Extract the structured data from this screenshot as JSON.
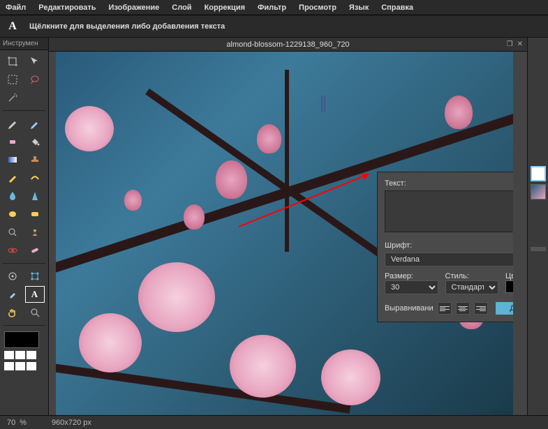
{
  "menu": {
    "items": [
      "Файл",
      "Редактировать",
      "Изображение",
      "Слой",
      "Коррекция",
      "Фильтр",
      "Просмотр",
      "Язык",
      "Справка"
    ]
  },
  "subbar": {
    "tool_letter": "A",
    "hint": "Щёлкните для выделения либо добавления текста"
  },
  "toolpanel": {
    "title": "Инструмен"
  },
  "document": {
    "title": "almond-blossom-1229138_960_720"
  },
  "textpanel": {
    "text_label": "Текст:",
    "font_label": "Шрифт:",
    "font_value": "Verdana",
    "size_label": "Размер:",
    "size_value": "30",
    "style_label": "Стиль:",
    "style_value": "Стандартный",
    "color_label": "Цвет:",
    "align_label": "Выравнивани",
    "ok_label": "Да"
  },
  "status": {
    "zoom": "70",
    "zoom_unit": "%",
    "dims": "960x720 px"
  }
}
